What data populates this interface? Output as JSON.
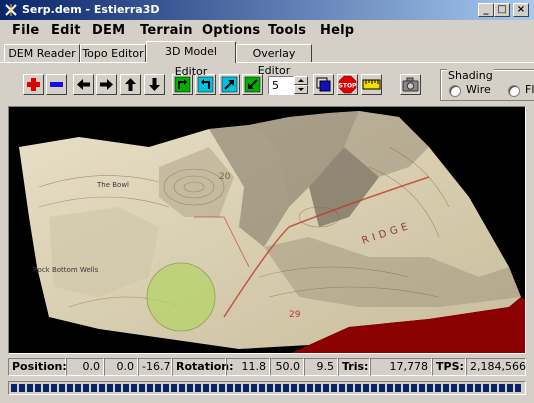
{
  "window": {
    "title": "Serp.dem - Estierra3D",
    "minimize": "_",
    "maximize": "□",
    "close": "×"
  },
  "menu": [
    "File",
    "Edit",
    "DEM",
    "Terrain",
    "Options",
    "Tools",
    "Help"
  ],
  "tabs": [
    {
      "label": "DEM Reader",
      "active": false
    },
    {
      "label": "Topo Editor",
      "active": false
    },
    {
      "label": "3D Model Editor",
      "active": true
    },
    {
      "label": "Overlay Editor",
      "active": false
    }
  ],
  "toolbar": {
    "buttons": [
      "zoom-in-icon",
      "zoom-out-icon",
      "pan-left-icon",
      "pan-right-icon",
      "pan-up-icon",
      "pan-down-icon",
      "rotate-left-icon",
      "rotate-right-icon",
      "tilt-up-icon",
      "tilt-down-icon"
    ],
    "step_value": "5",
    "buttons_after": [
      "render-icon",
      "stop-icon",
      "ruler-icon",
      "camera-icon"
    ]
  },
  "shading": {
    "label": "Shading",
    "options": [
      "Wire",
      "Fl"
    ],
    "selected": ""
  },
  "status": {
    "position_label": "Position:",
    "position": [
      "0.0",
      "0.0",
      "-16.7"
    ],
    "rotation_label": "Rotation:",
    "rotation": [
      "11.8",
      "50.0",
      "9.5"
    ],
    "tris_label": "Tris:",
    "tris": "17,778",
    "tps_label": "TPS:",
    "tps": "2,184,566"
  },
  "progress": {
    "fraction": 1.0
  },
  "map_labels": {
    "ridge": "RIDGE",
    "bowl": "The Bowl",
    "wells": "Rock Bottom Wells",
    "n20": "20",
    "n29": "29"
  },
  "colors": {
    "titlebar_start": "#0a246a",
    "titlebar_end": "#a6caf0",
    "face": "#d4d0c8",
    "progress": "#0a246a"
  }
}
